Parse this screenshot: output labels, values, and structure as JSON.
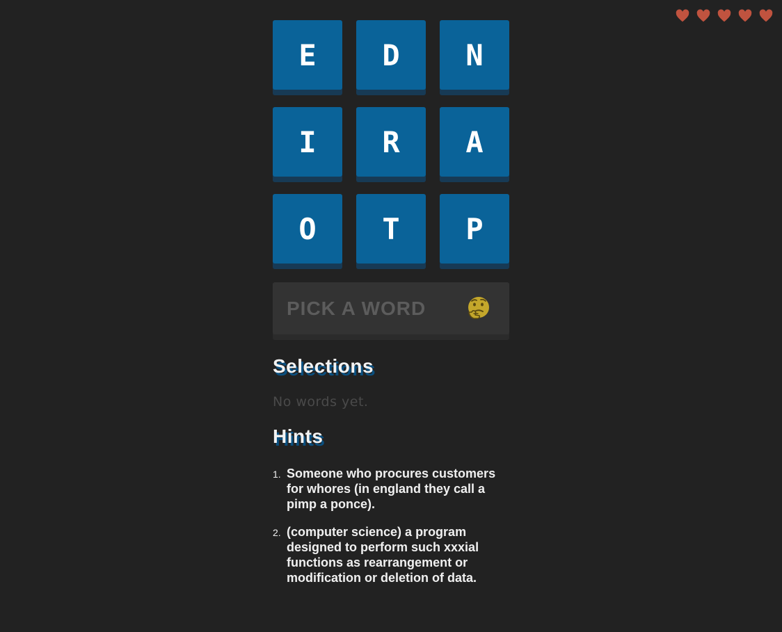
{
  "lives": {
    "count": 5,
    "heart_color": "#c0533f"
  },
  "tiles": [
    {
      "letter": "E"
    },
    {
      "letter": "D"
    },
    {
      "letter": "N"
    },
    {
      "letter": "I"
    },
    {
      "letter": "R"
    },
    {
      "letter": "A"
    },
    {
      "letter": "O"
    },
    {
      "letter": "T"
    },
    {
      "letter": "P"
    }
  ],
  "word_input": {
    "placeholder": "PICK A WORD",
    "icon": "thinking-face-icon"
  },
  "selections": {
    "title": "Selections",
    "empty_text": "No words yet."
  },
  "hints": {
    "title": "Hints",
    "items": [
      {
        "number": "1.",
        "text": "Someone who procures customers for whores (in england they call a pimp a ponce)."
      },
      {
        "number": "2.",
        "text": "(computer science) a program designed to perform such xxxial functions as rearrangement or modification or deletion of data."
      }
    ]
  },
  "colors": {
    "background": "#222222",
    "tile": "#0a6399",
    "tile_shadow": "#173a55"
  }
}
